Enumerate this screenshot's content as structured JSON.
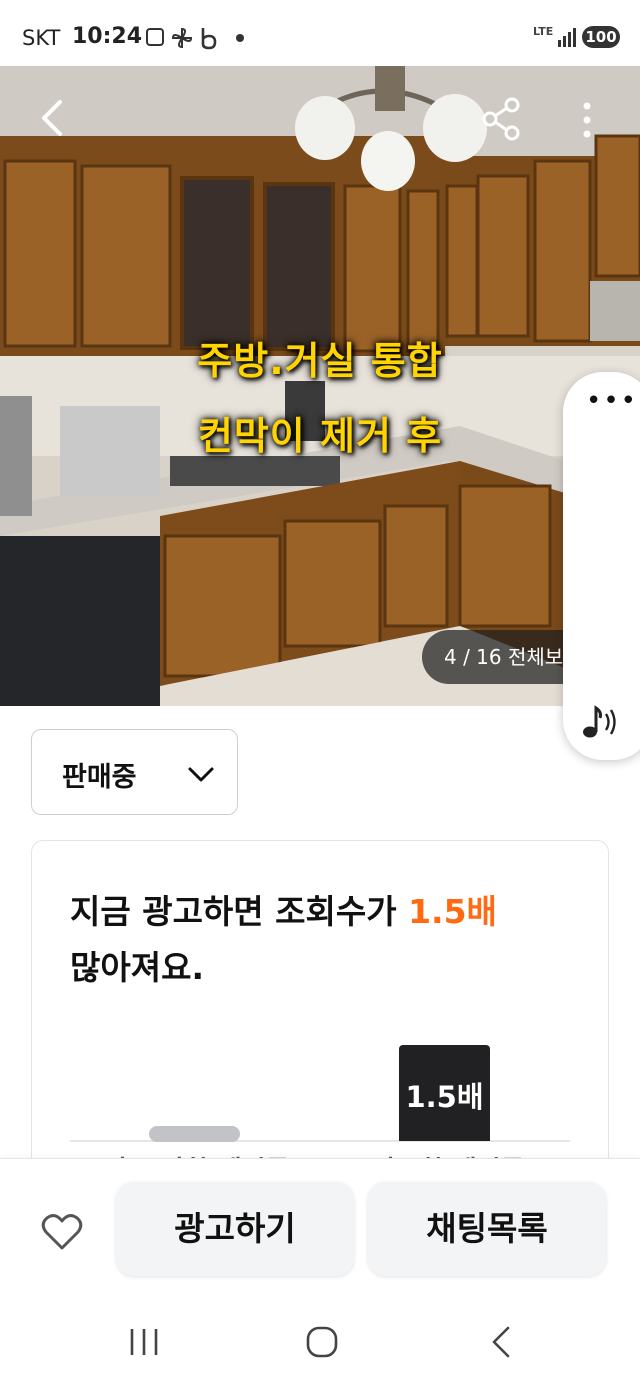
{
  "status_bar": {
    "carrier": "SKT",
    "time": "10:24",
    "network": "LTE",
    "battery": "100",
    "icons": [
      "screenshot-icon",
      "pinwheel-icon",
      "b-app-icon",
      "notification-dot-icon",
      "signal-bars-icon",
      "battery-icon"
    ]
  },
  "photo": {
    "caption_line1": "주방.거실 통합",
    "caption_line2": "컨막이 제거 후",
    "counter": "4 / 16  전체보",
    "icons": [
      "back-arrow-icon",
      "share-icon",
      "more-vertical-icon"
    ]
  },
  "side_panel": {
    "icons": [
      "more-horizontal-icon",
      "audio-note-icon"
    ]
  },
  "sale_status": {
    "selected": "판매중",
    "icon": "chevron-down-icon"
  },
  "ad_card": {
    "text_prefix": "지금 광고하면 조회수가 ",
    "text_highlight": "1.5배",
    "text_suffix": "많아져요.",
    "highlight_color": "#ff6a13",
    "chart_bar_label": "1.5배",
    "cut_label_left": "광고 안한 게시글",
    "cut_label_right": "광고한 게시글"
  },
  "bottom_bar": {
    "advertise_label": "광고하기",
    "chat_list_label": "채팅목록",
    "icons": [
      "heart-icon"
    ]
  },
  "nav_bar": {
    "icons": [
      "recent-apps-icon",
      "home-icon",
      "back-icon"
    ]
  }
}
